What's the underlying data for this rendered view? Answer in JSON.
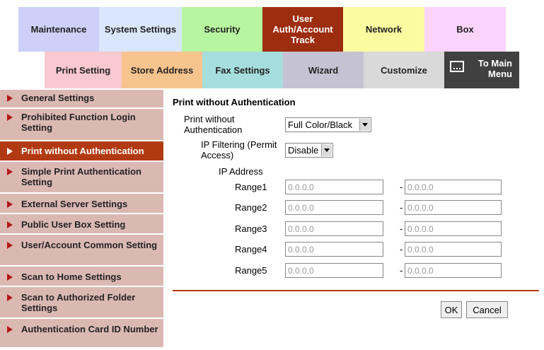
{
  "top_tabs": [
    {
      "label": "Maintenance",
      "color": "#cdd0f8"
    },
    {
      "label": "System Settings",
      "color": "#d9e6fb"
    },
    {
      "label": "Security",
      "color": "#b7f5a1"
    },
    {
      "label": "User Auth/Account Track",
      "color": "#9d2d0f",
      "active": true
    },
    {
      "label": "Network",
      "color": "#fbfca0"
    },
    {
      "label": "Box",
      "color": "#fbd3fb"
    }
  ],
  "sub_tabs": [
    {
      "label": "Print Setting",
      "color": "#f9c8d0"
    },
    {
      "label": "Store Address",
      "color": "#f8c48e"
    },
    {
      "label": "Fax Settings",
      "color": "#a6dede"
    },
    {
      "label": "Wizard",
      "color": "#c4c2d3"
    },
    {
      "label": "Customize",
      "color": "#d9d9d9"
    }
  ],
  "main_menu": {
    "label_line1": "To Main",
    "label_line2": "Menu",
    "color": "#404040"
  },
  "sidebar": {
    "items": [
      {
        "label": "General Settings"
      },
      {
        "label": "Prohibited Function Login Setting"
      },
      {
        "label": "Print without Authentication",
        "active": true
      },
      {
        "label": "Simple Print Authentication Setting"
      },
      {
        "label": "External Server Settings"
      },
      {
        "label": "Public User Box Setting"
      },
      {
        "label": "User/Account Common Setting"
      },
      {
        "label": "Scan to Home Settings"
      },
      {
        "label": "Scan to Authorized Folder Settings"
      },
      {
        "label": "Authentication Card ID Number"
      }
    ]
  },
  "form": {
    "section_title": "Print without Authentication",
    "print_without_auth_label": "Print without Authentication",
    "print_without_auth_value": "Full Color/Black",
    "ip_filtering_label": "IP Filtering (Permit Access)",
    "ip_filtering_value": "Disable",
    "ip_address_label": "IP Address",
    "ranges": [
      {
        "label": "Range1",
        "from": "0.0.0.0",
        "to": "0.0.0.0"
      },
      {
        "label": "Range2",
        "from": "0.0.0.0",
        "to": "0.0.0.0"
      },
      {
        "label": "Range3",
        "from": "0.0.0.0",
        "to": "0.0.0.0"
      },
      {
        "label": "Range4",
        "from": "0.0.0.0",
        "to": "0.0.0.0"
      },
      {
        "label": "Range5",
        "from": "0.0.0.0",
        "to": "0.0.0.0"
      }
    ],
    "range_separator": "-"
  },
  "buttons": {
    "ok": "OK",
    "cancel": "Cancel"
  }
}
